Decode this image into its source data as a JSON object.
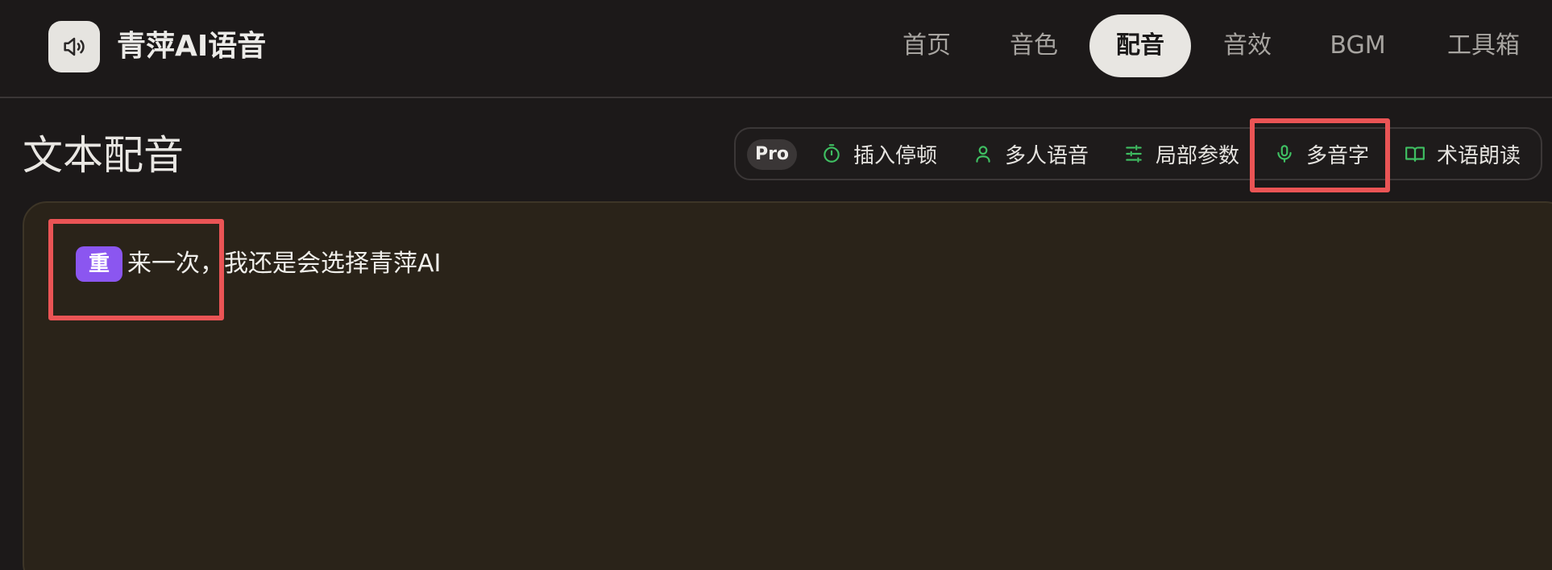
{
  "app": {
    "title": "青萍AI语音"
  },
  "nav": {
    "items": [
      {
        "label": "首页"
      },
      {
        "label": "音色"
      },
      {
        "label": "配音"
      },
      {
        "label": "音效"
      },
      {
        "label": "BGM"
      },
      {
        "label": "工具箱"
      }
    ],
    "active": "配音"
  },
  "section": {
    "title": "文本配音"
  },
  "toolbar": {
    "pro_label": "Pro",
    "tools": [
      {
        "label": "插入停顿",
        "icon": "timer-icon"
      },
      {
        "label": "多人语音",
        "icon": "user-icon"
      },
      {
        "label": "局部参数",
        "icon": "sliders-icon"
      },
      {
        "label": "多音字",
        "icon": "microphone-icon"
      },
      {
        "label": "术语朗读",
        "icon": "book-open-icon"
      }
    ]
  },
  "editor": {
    "tag": "重",
    "text_part1": "来一次，",
    "text_part2": "我还是会选择青萍AI"
  },
  "colors": {
    "accent_green": "#3fbf62",
    "tag_purple": "#8b56f0",
    "highlight_red": "#ea5455",
    "editor_bg": "#2a2319"
  }
}
